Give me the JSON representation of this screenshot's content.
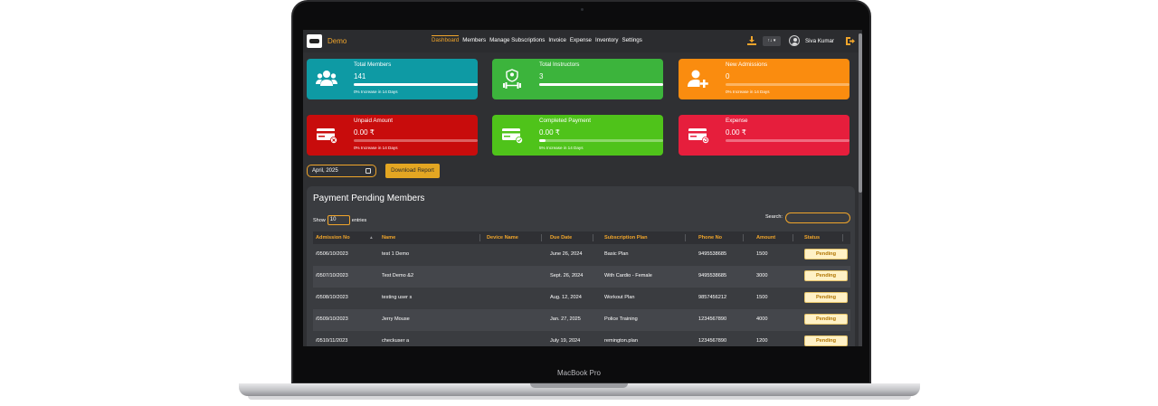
{
  "device": {
    "label": "MacBook Pro"
  },
  "app": {
    "name": "Demo"
  },
  "nav": {
    "items": [
      "Dashboard",
      "Members",
      "Manage Subscriptions",
      "Invoice",
      "Expense",
      "Inventory",
      "Settings"
    ],
    "active": "Dashboard"
  },
  "header": {
    "sort_label": "↑↓ ▾",
    "user_name": "Siva Kumar"
  },
  "cards": [
    {
      "title": "Total Members",
      "value": "141",
      "footer": "0% Increase in 14 Days",
      "color": "#0e9aa4",
      "progress": 1.0,
      "icon": "users-icon"
    },
    {
      "title": "Total Instructors",
      "value": "3",
      "footer": "",
      "color": "#3cb43c",
      "progress": 1.0,
      "icon": "dumbbell-icon"
    },
    {
      "title": "New Admissions",
      "value": "0",
      "footer": "0% Increase in 14 Days",
      "color": "#fa8c0f",
      "progress": 0.0,
      "icon": "add-user-icon"
    },
    {
      "title": "Unpaid Amount",
      "value": "0.00 ₹",
      "footer": "0% Increase in 14 Days",
      "color": "#c80c0c",
      "progress": 0.0,
      "icon": "card-cancel-icon"
    },
    {
      "title": "Completed Payment",
      "value": "0.00 ₹",
      "footer": "5% Increase in 14 Days",
      "color": "#4fc31a",
      "progress": 0.05,
      "icon": "card-check-icon"
    },
    {
      "title": "Expense",
      "value": "0.00 ₹",
      "footer": "",
      "color": "#e61e3c",
      "progress": 0.0,
      "icon": "card-refresh-icon"
    }
  ],
  "filters": {
    "month": "April, 2025",
    "report_button": "Download Report"
  },
  "table": {
    "title": "Payment Pending Members",
    "show_label": "Show",
    "page_size": "10",
    "entries_label": "entries",
    "search_label": "Search:",
    "columns": [
      "Admission No",
      "Name",
      "Device Name",
      "Due Date",
      "Subscription Plan",
      "Phone No",
      "Amount",
      "Status"
    ],
    "rows": [
      [
        "/0506/10/2023",
        "test 1 Demo",
        "",
        "June 26, 2024",
        "Basic Plan",
        "9495538685",
        "1500",
        "Pending"
      ],
      [
        "/0507/10/2023",
        "Test Demo &2",
        "",
        "Sept. 26, 2024",
        "With Cardio - Female",
        "9495538685",
        "3000",
        "Pending"
      ],
      [
        "/0508/10/2023",
        "testing user s",
        "",
        "Aug. 12, 2024",
        "Workout Plan",
        "9857456212",
        "1500",
        "Pending"
      ],
      [
        "/0509/10/2023",
        "Jerry Mouse",
        "",
        "Jan. 27, 2025",
        "Police Training",
        "1234567890",
        "4000",
        "Pending"
      ],
      [
        "/0510/11/2023",
        "checkuser a",
        "",
        "July 19, 2024",
        "remington.plan",
        "1234567890",
        "1200",
        "Pending"
      ]
    ]
  }
}
